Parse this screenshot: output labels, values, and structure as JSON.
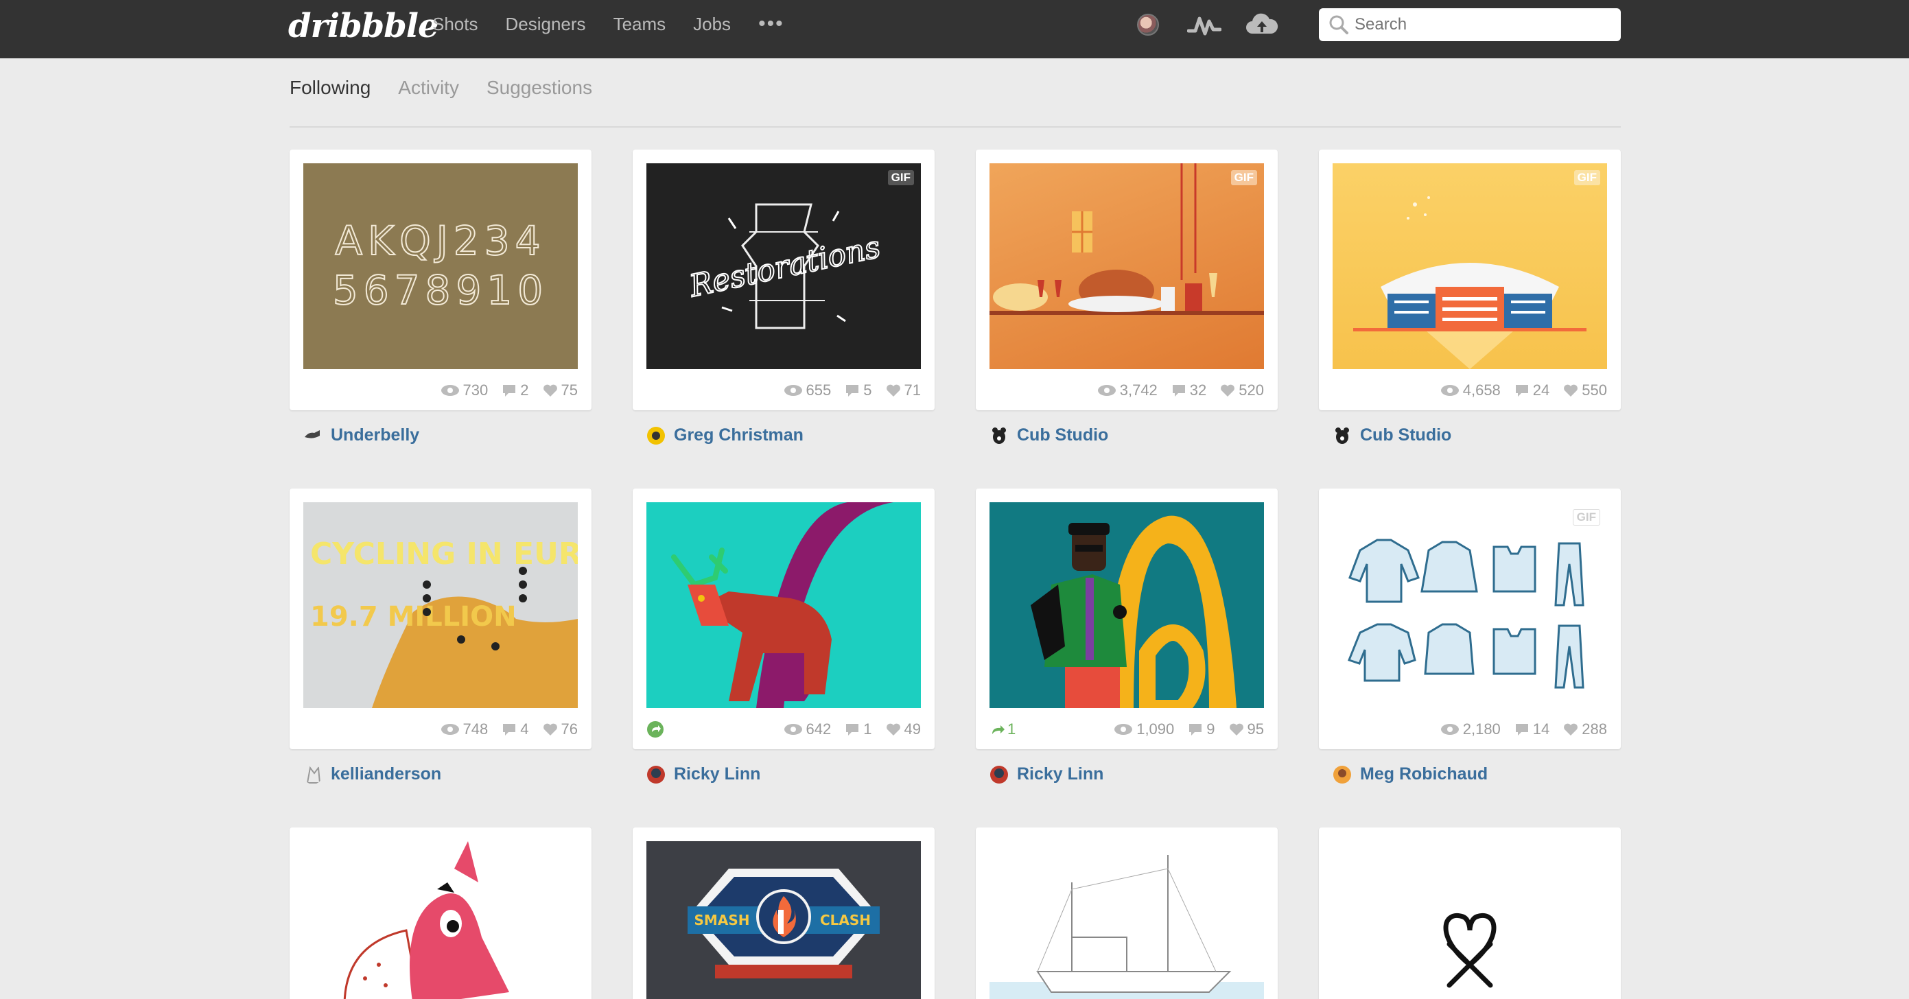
{
  "topbar": {
    "logo": "dribbble",
    "nav": [
      "Shots",
      "Designers",
      "Teams",
      "Jobs"
    ],
    "more": "•••",
    "search_placeholder": "Search",
    "icons": [
      "avatar",
      "activity-icon",
      "cloud-upload-icon",
      "search-icon"
    ]
  },
  "subnav": {
    "tabs": [
      "Following",
      "Activity",
      "Suggestions"
    ],
    "active": "Following"
  },
  "shots": [
    {
      "author": "Underbelly",
      "views": "730",
      "comments": "2",
      "likes": "75",
      "gif": "",
      "art": "AKQJ234 5678910"
    },
    {
      "author": "Greg Christman",
      "views": "655",
      "comments": "5",
      "likes": "71",
      "gif": "GIF",
      "art": "Restorations"
    },
    {
      "author": "Cub Studio",
      "views": "3,742",
      "comments": "32",
      "likes": "520",
      "gif": "GIF"
    },
    {
      "author": "Cub Studio",
      "views": "4,658",
      "comments": "24",
      "likes": "550",
      "gif": "GIF"
    },
    {
      "author": "kellianderson",
      "views": "748",
      "comments": "4",
      "likes": "76",
      "gif": "",
      "art": "CYCLING IN EUROPE",
      "art_sub": "19.7 MILLION"
    },
    {
      "author": "Ricky Linn",
      "views": "642",
      "comments": "1",
      "likes": "49",
      "gif": ""
    },
    {
      "author": "Ricky Linn",
      "views": "1,090",
      "comments": "9",
      "likes": "95",
      "gif": "",
      "rebound": "1"
    },
    {
      "author": "Meg Robichaud",
      "views": "2,180",
      "comments": "14",
      "likes": "288",
      "gif": "GIF"
    }
  ],
  "bottom_row": {
    "badge_top": "SMASH",
    "badge_right": "CLASH"
  },
  "colors": {
    "topbar": "#333333",
    "background": "#ebebeb",
    "author_link": "#3a6e9c",
    "rebound": "#6bb35b"
  }
}
